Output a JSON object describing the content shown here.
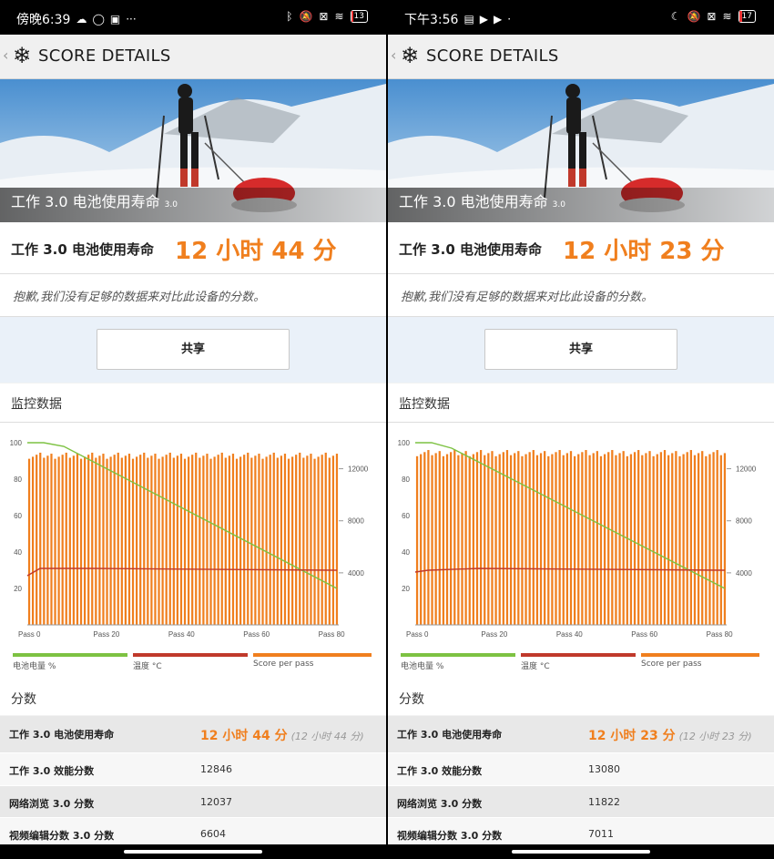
{
  "colors": {
    "accent": "#f07f1e",
    "battery_line": "#7dc242",
    "temp_line": "#c0392b",
    "score_bars": "#f07f1e"
  },
  "left": {
    "status": {
      "time": "傍晚6:39",
      "battery": "13",
      "icons": [
        "cloud-icon",
        "circle-icon",
        "game-icon",
        "more-icon",
        "bluetooth-icon",
        "mute-icon",
        "no-sim-icon",
        "wifi-icon",
        "battery-icon"
      ]
    },
    "title": "SCORE DETAILS",
    "hero_caption": "工作 3.0 电池使用寿命",
    "hero_version": "3.0",
    "result_label": "工作 3.0 电池使用寿命",
    "result_value": "12 小时 44 分",
    "sorry": "抱歉,我们没有足够的数据来对比此设备的分数。",
    "share": "共享",
    "monitor_title": "监控数据",
    "score_title": "分数",
    "legend": [
      "电池电量 %",
      "温度 °C",
      "Score per pass"
    ],
    "rows": [
      {
        "label": "工作 3.0 电池使用寿命",
        "value": "12 小时 44 分",
        "sub": "(12 小时 44 分)"
      },
      {
        "label": "工作 3.0 效能分数",
        "value": "12846"
      },
      {
        "label": "网络浏览 3.0 分数",
        "value": "12037"
      },
      {
        "label": "视频编辑分数 3.0 分数",
        "value": "6604"
      }
    ]
  },
  "right": {
    "status": {
      "time": "下午3:56",
      "battery": "17",
      "icons": [
        "save-icon",
        "youtube-icon",
        "youtube-icon",
        "dot-icon",
        "moon-icon",
        "mute-icon",
        "no-sim-icon",
        "wifi-icon",
        "battery-icon"
      ]
    },
    "title": "SCORE DETAILS",
    "hero_caption": "工作 3.0 电池使用寿命",
    "hero_version": "3.0",
    "result_label": "工作 3.0 电池使用寿命",
    "result_value": "12 小时 23 分",
    "sorry": "抱歉,我们没有足够的数据来对比此设备的分数。",
    "share": "共享",
    "monitor_title": "监控数据",
    "score_title": "分数",
    "legend": [
      "电池电量 %",
      "温度 °C",
      "Score per pass"
    ],
    "rows": [
      {
        "label": "工作 3.0 电池使用寿命",
        "value": "12 小时 23 分",
        "sub": "(12 小时 23 分)"
      },
      {
        "label": "工作 3.0 效能分数",
        "value": "13080"
      },
      {
        "label": "网络浏览 3.0 分数",
        "value": "11822"
      },
      {
        "label": "视频编辑分数 3.0 分数",
        "value": "7011"
      }
    ]
  },
  "chart_data": [
    {
      "type": "bar",
      "title": "",
      "x_ticks": [
        "Pass 0",
        "Pass 20",
        "Pass 40",
        "Pass 60",
        "Pass 80"
      ],
      "y_left_ticks": [
        20,
        40,
        60,
        80,
        100
      ],
      "y_right_ticks": [
        "4000",
        "8000",
        "12000"
      ],
      "ylim_left": [
        0,
        100
      ],
      "ylim_right": [
        0,
        14000
      ],
      "passes": 84,
      "series": [
        {
          "name": "电池电量 %",
          "type": "line",
          "values": [
            100,
            100,
            98,
            20
          ]
        },
        {
          "name": "温度 °C",
          "type": "line",
          "values": [
            27,
            31,
            31,
            30
          ]
        },
        {
          "name": "Score per pass",
          "type": "bar",
          "value": 13000
        }
      ]
    },
    {
      "type": "bar",
      "title": "",
      "x_ticks": [
        "Pass 0",
        "Pass 20",
        "Pass 40",
        "Pass 60",
        "Pass 80"
      ],
      "y_left_ticks": [
        20,
        40,
        60,
        80,
        100
      ],
      "y_right_ticks": [
        "4000",
        "8000",
        "12000"
      ],
      "ylim_left": [
        0,
        100
      ],
      "ylim_right": [
        0,
        14000
      ],
      "passes": 83,
      "series": [
        {
          "name": "电池电量 %",
          "type": "line",
          "values": [
            100,
            100,
            97,
            20
          ]
        },
        {
          "name": "温度 °C",
          "type": "line",
          "values": [
            29,
            30,
            31,
            30
          ]
        },
        {
          "name": "Score per pass",
          "type": "bar",
          "value": 13200
        }
      ]
    }
  ]
}
